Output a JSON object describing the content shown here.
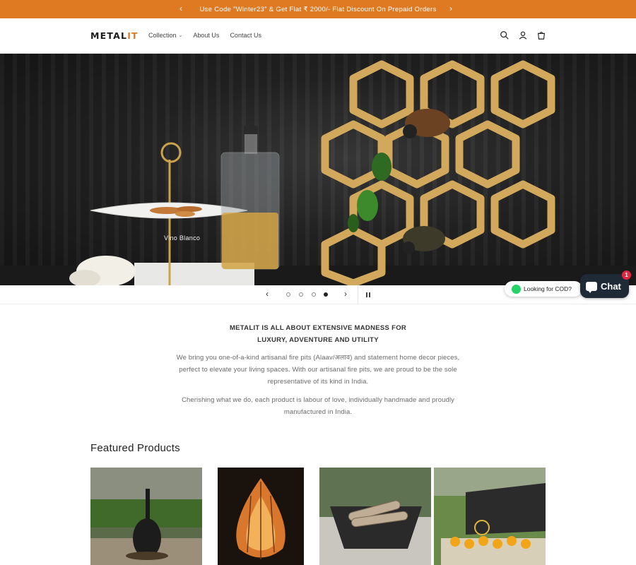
{
  "announcement": {
    "text": "Use Code \"Winter23\" & Get Flat ₹ 2000/- Flat Discount On Prepaid Orders",
    "prev": "‹",
    "next": "›"
  },
  "header": {
    "logo_main": "METAL",
    "logo_accent": "IT",
    "nav": [
      {
        "label": "Collection",
        "has_dropdown": true
      },
      {
        "label": "About Us"
      },
      {
        "label": "Contact Us"
      }
    ],
    "icons": [
      "search-icon",
      "account-icon",
      "cart-icon"
    ]
  },
  "hero": {
    "caption": "Vino Blanco",
    "slides_total": 4,
    "active_slide": 4
  },
  "slider": {
    "prev": "‹",
    "next": "›"
  },
  "widgets": {
    "cod_label": "Looking for COD?",
    "chat_label": "Chat",
    "chat_badge": "1"
  },
  "intro": {
    "title_line1": "METALIT IS ALL ABOUT EXTENSIVE MADNESS FOR",
    "title_line2": "LUXURY, ADVENTURE AND UTILITY",
    "p1_line1": "We bring you one-of-a-kind artisanal fire pits (Alaav/अलाव) and statement home decor pieces,",
    "p1_line2": "perfect to elevate your living spaces. With our artisanal fire pits, we are proud to be the sole",
    "p1_line3": "representative of its kind in India.",
    "p2_line1": "Cherishing what we do, each product is labour of love, individually handmade and proudly",
    "p2_line2": "manufactured in India."
  },
  "featured": {
    "title": "Featured Products"
  },
  "colors": {
    "accent": "#e07a22",
    "chat_bg": "#1e2a36",
    "badge": "#e0273f"
  }
}
